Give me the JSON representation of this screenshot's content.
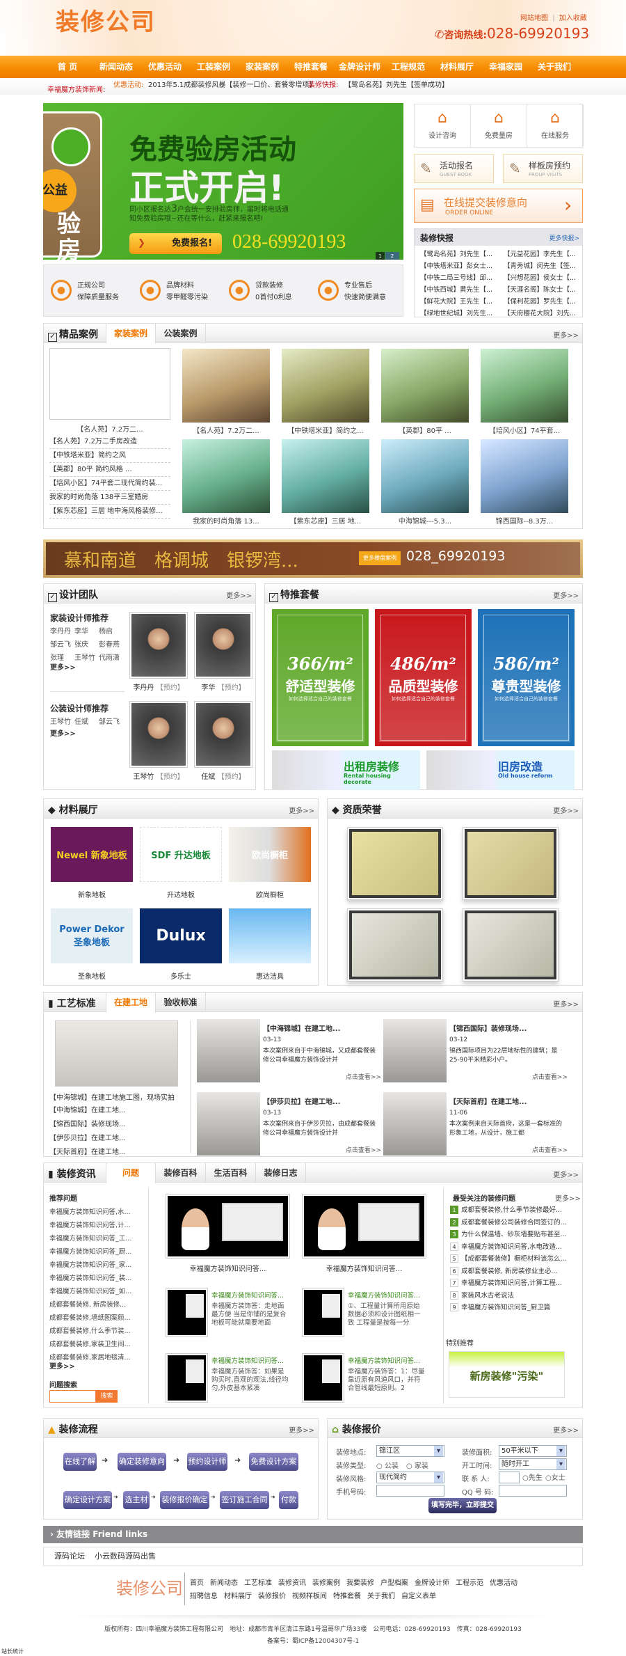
{
  "header": {
    "logo": "装修公司",
    "links": [
      "网站地图",
      "|",
      "加入收藏"
    ],
    "hotline_label": "咨询热线:",
    "hotline": "028-69920193"
  },
  "nav": [
    "首 页",
    "新闻动态",
    "优惠活动",
    "工装案例",
    "家装案例",
    "特推套餐",
    "金牌设计师",
    "工程规范",
    "材料展厅",
    "幸福家园",
    "关于我们"
  ],
  "ticker": {
    "label": "幸福魔方装饰新闻:",
    "promo_label": "优惠活动:",
    "promo": "2013年5.1成都装修风暴【装修一口价、套餐零增项】",
    "news_label": "装修快报:",
    "news": "【鹭岛名苑】刘先生【签单成功】"
  },
  "banner": {
    "tag1": "公益",
    "tag2": "验房",
    "title1": "免费验房活动",
    "title2": "正式开启!",
    "desc_a": "同小区报名达",
    "desc_num": "3",
    "desc_b": "户会统一安排验房师，届时将电话通",
    "desc_c": "知免费验房哦~还在等什么，赶紧来报名吧!",
    "button": "免费报名!",
    "phone": "028-69920193",
    "pages": [
      "1",
      "2"
    ]
  },
  "features": [
    {
      "icon": "正",
      "t1": "正规公司",
      "t2": "保障质量服务"
    },
    {
      "icon": "doc",
      "t1": "品牌材料",
      "t2": "零甲醛零污染"
    },
    {
      "icon": "款",
      "t1": "贷款装修",
      "t2": "0首付0利息"
    },
    {
      "icon": "售",
      "t1": "专业售后",
      "t2": "快速简便满意"
    }
  ],
  "quick": [
    {
      "icon": "house-icon",
      "label": "设计咨询"
    },
    {
      "icon": "pencil-ruler-icon",
      "label": "免费量房"
    },
    {
      "icon": "handshake-heart-icon",
      "label": "在线服务"
    }
  ],
  "cards": [
    {
      "title": "活动报名",
      "sub": "GUEST BOOK"
    },
    {
      "title": "样板房预约",
      "sub": "FROUP VISITS"
    }
  ],
  "order": {
    "title": "在线提交装修意向",
    "sub": "ORDER ONLINE"
  },
  "flash": {
    "title": "装修快报",
    "more": "更多快报>",
    "items": [
      "【鹭岛名苑】刘先生【...",
      "【元益花园】李先生【...",
      "【中铁塔米亚】彭女士...",
      "【青秀城】闵先生【签...",
      "【中铁二局三号线】邱...",
      "【兴想花园】侯女士【...",
      "【中铁西城】黄先生【...",
      "【天涯名阁】陈女士【...",
      "【鲜花大院】王先生【...",
      "【保利花园】罗先生【...",
      "【绿地世纪城】刘先生...",
      "【天府樱花大院】刘先..."
    ]
  },
  "cases": {
    "title": "精品案例",
    "tabs": [
      "家装案例",
      "公装案例"
    ],
    "more": "更多>>",
    "featured_caption": "【名人苑】7.2万二...",
    "list": [
      "【名人苑】7.2万二手房改造",
      "【中铁塔米亚】简约之风",
      "【英郡】80平 简约风格 ...",
      "【培风小区】74平套二现代简约装...",
      "我家的时尚角落 138平三室婚房",
      "【紫东芯座】三居 地中海风格装修..."
    ],
    "grid": [
      "【名人苑】7.2万二...",
      "【中铁塔米亚】简约之...",
      "【英郡】80平 ...",
      "【培风小区】74平套...",
      "我家的时尚角落 13...",
      "【紫东芯座】三居 地...",
      "中海锦城---5.3...",
      "锦西国际--8.3万..."
    ]
  },
  "ad": {
    "text": "慕和南道　格调城　银锣湾...",
    "button": "更多楼盘案例",
    "phone": "028_69920193"
  },
  "team": {
    "title": "设计团队",
    "more": "更多>>",
    "home_title": "家装设计师推荐",
    "home_names": [
      "李丹丹",
      "李华",
      "杨启",
      "邹云飞",
      "张庆",
      "彭春燕",
      "张瑾",
      "王琴竹",
      "代雨潇"
    ],
    "home_more": "更多>>",
    "office_title": "公装设计师推荐",
    "office_names": [
      "王琴竹",
      "任斌",
      "邹云飞"
    ],
    "office_more": "更多>>",
    "book": "【预约】",
    "photos": [
      {
        "name": "李丹丹"
      },
      {
        "name": "李华"
      },
      {
        "name": "王琴竹"
      },
      {
        "name": "任斌"
      }
    ]
  },
  "packages": {
    "title": "特推套餐",
    "more": "更多>>",
    "items": [
      {
        "price": "366/m²",
        "name": "舒适型装修",
        "sub": "如何选择适合自己的装修套餐",
        "color": "#5fa82a"
      },
      {
        "price": "486/m²",
        "name": "品质型装修",
        "sub": "如何选择适合自己的装修套餐",
        "color": "#c8181c"
      },
      {
        "price": "586/m²",
        "name": "尊贵型装修",
        "sub": "如何选择适合自己的装修套餐",
        "color": "#1e72b8"
      }
    ],
    "banners": [
      {
        "cn": "出租房装修",
        "en": "Rental housing decorate",
        "color": "#1a9a2a"
      },
      {
        "cn": "旧房改造",
        "en": "Old house reform",
        "color": "#1a5ab8"
      }
    ]
  },
  "materials": {
    "title": "材料展厅",
    "more": "更多>>",
    "items": [
      {
        "name": "新象地板",
        "logo": "Newel 新象地板"
      },
      {
        "name": "升达地板",
        "logo": "SDF 升达地板"
      },
      {
        "name": "欧尚橱柜",
        "logo": "欧尚橱柜"
      },
      {
        "name": "圣象地板",
        "logo": "Power Dekor 圣象地板"
      },
      {
        "name": "多乐士",
        "logo": "Dulux"
      },
      {
        "name": "惠达洁具",
        "logo": ""
      }
    ]
  },
  "honors": {
    "title": "资质荣誉",
    "more": "更多>>"
  },
  "craft": {
    "title": "工艺标准",
    "tabs": [
      "在建工地",
      "验收标准"
    ],
    "more": "更多>>",
    "featured_caption": "【中海锦城】在建工地施工图，现场实拍",
    "list": [
      "【中海锦城】在建工地...",
      "【锦西国际】装修现场...",
      "【伊莎贝拉】在建工地...",
      "【天际首府】在建工地..."
    ],
    "view": "点击查看>>",
    "items": [
      {
        "title": "【中海锦城】在建工地...",
        "date": "03-13",
        "desc": "本次案例来自于中海锦城，又成都套餐装修公司幸福魔方装饰设计并"
      },
      {
        "title": "【锦西国际】装修现场...",
        "date": "03-12",
        "desc": "锦西国际项目为22层地标性的建筑；是25-90平米精彩小户。"
      },
      {
        "title": "【伊莎贝拉】在建工地...",
        "date": "03-13",
        "desc": "本次案例来自于伊莎贝拉，由成都套餐装修公司幸福魔方装饰设计并"
      },
      {
        "title": "【天际首府】在建工地...",
        "date": "11-06",
        "desc": "本次案例来自天际首府，这是一套标准的形象工地，从设计，施工都"
      }
    ]
  },
  "news": {
    "title": "装修资讯",
    "tabs": [
      "问题",
      "装修百科",
      "生活百科",
      "装修日志"
    ],
    "more": "更多>>",
    "rec_title": "推荐问题",
    "rec": [
      "幸福魔方装饰知识问答,水...",
      "幸福魔方装饰知识问答,计...",
      "幸福魔方装饰知识问答_工...",
      "幸福魔方装饰知识问答_厨...",
      "幸福魔方装饰知识问答_家...",
      "幸福魔方装饰知识问答_装...",
      "幸福魔方装饰知识问答_如...",
      "成都套餐装修, 新房装修...",
      "成都套餐装修,墙纸图案颜...",
      "成都套餐装修,什么季节装...",
      "成都套餐装修,家装卫生间...",
      "成都套餐装修,家居地毯清..."
    ],
    "rec_more": "更多>>",
    "search_title": "问题搜索",
    "search_value": "",
    "search_button": "搜索",
    "videos": [
      "幸福魔方装饰知识问答...",
      "幸福魔方装饰知识问答..."
    ],
    "qa": [
      {
        "title": "幸福魔方装饰知识问答...",
        "desc": "幸福魔方装饰答：走地面最方便 当是你铺的是复合地板可能就需要地面"
      },
      {
        "title": "幸福魔方装饰知识问答...",
        "desc": "①、工程量计算所用原始数据必须和设计图纸相一致 工程量是按每一分"
      },
      {
        "title": "幸福魔方装饰知识问答...",
        "desc": "幸福魔方装饰答：如果是购买时,直观的观法,线径均匀,外皮基本紧凑"
      },
      {
        "title": "幸福魔方装饰知识问答...",
        "desc": "幸福魔方装饰答：1：尽量靠近原有风道风口，并符合管线最短原则。2"
      }
    ],
    "hot_title": "最受关注的装修问题",
    "hot_more": "更多>>",
    "hot": [
      "成都套餐装修,什么季节装修最好...",
      "成都套餐装修公司装修合同签订的...",
      "为什么保温墙、砂灰墙要贴布甚至...",
      "幸福魔方装饰知识问答,水电改造...",
      "【成都套餐装修】橱柜材料该怎么...",
      "成都套餐装修, 新房装修业主必...",
      "幸福魔方装饰知识问答,计算工程...",
      "家装风水古老说法",
      "幸福魔方装饰知识问答_厨卫篇"
    ],
    "special_title": "特别推荐",
    "special_img": "新房装修\"污染\""
  },
  "flow": {
    "title": "装修流程",
    "more": "更多>>",
    "row1": [
      "在线了解",
      "确定装修意向",
      "预约设计师",
      "免费设计方案"
    ],
    "row2": [
      "确定设计方案",
      "选主材",
      "装修报价确定",
      "签订施工合同",
      "付款"
    ]
  },
  "quote": {
    "title": "装修报价",
    "more": "更多>>",
    "location_label": "装修地点:",
    "location": "锦江区",
    "area_label": "装修面积:",
    "area": "50平米以下",
    "type_label": "装修类型:",
    "type_opts": [
      "公装",
      "家装"
    ],
    "start_label": "开工时间:",
    "start": "随时开工",
    "style_label": "装修风格:",
    "style": "现代简约",
    "contact_label": "联 系 人:",
    "contact": "",
    "gender": [
      "先生",
      "女士"
    ],
    "phone_label": "手机号码:",
    "phone": "",
    "qq_label": "QQ 号 码:",
    "qq": "",
    "submit": "填写完毕，立即提交"
  },
  "friends": {
    "title": "友情链接 Friend links",
    "links": [
      "源码论坛",
      "小云数码源码出售"
    ]
  },
  "footer": {
    "logo": "装修公司",
    "nav1": [
      "首页",
      "新闻动态",
      "工艺标准",
      "装修资讯",
      "装修案例",
      "我要装修",
      "户型档案",
      "金牌设计师",
      "工程示范",
      "优惠活动"
    ],
    "nav2": [
      "招聘信息",
      "材料展厅",
      "装修报价",
      "视频样板间",
      "特推套餐",
      "关于我们",
      "自定义表单"
    ],
    "copyright": "版权所有：四川幸福魔方装饰工程有限公司　地址：成都市青羊区清江东路1号温哥华广场33楼　公司电话：028-69920193　传真：028-69920193",
    "icp": "备案号：蜀ICP备12004307号-1",
    "stats": "站长统计"
  },
  "colors": {
    "accent": "#f07800",
    "nav": "#f68a00",
    "banner_green": "#4caf25"
  }
}
